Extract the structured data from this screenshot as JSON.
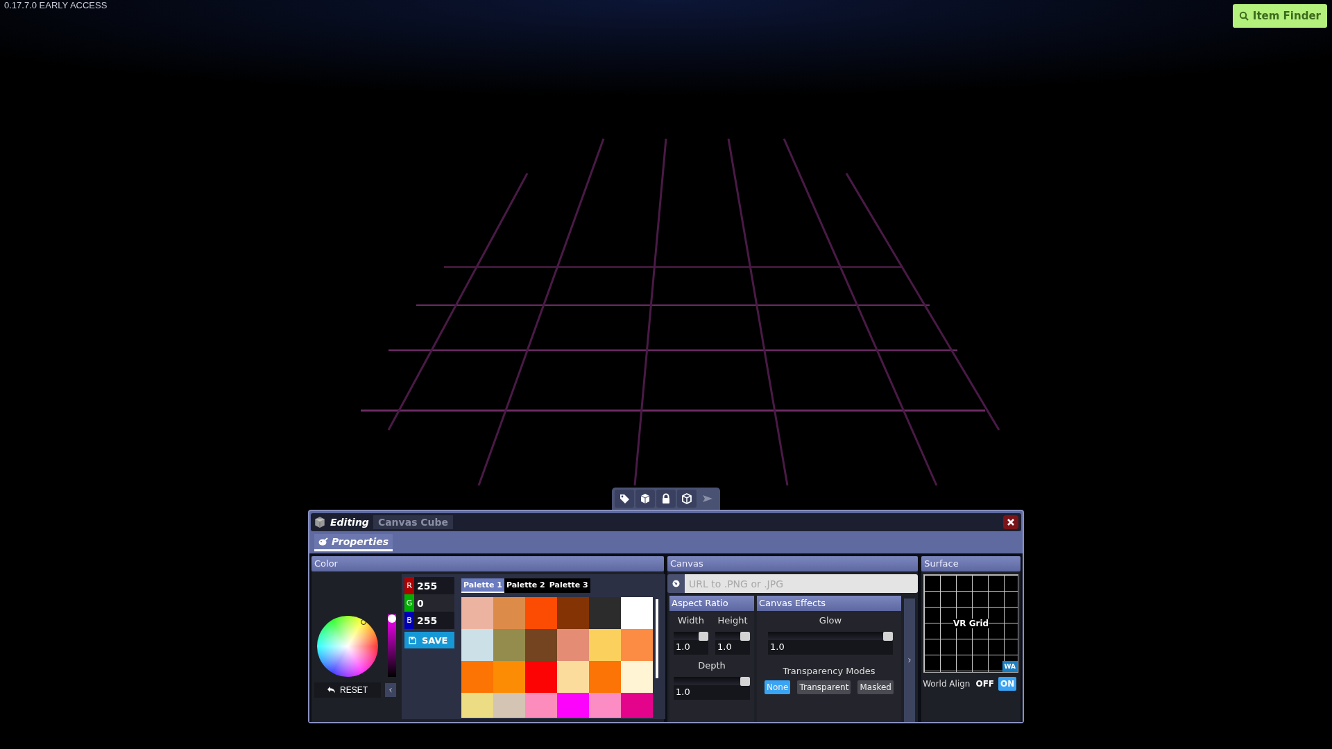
{
  "version_label": "0.17.7.0 EARLY ACCESS",
  "item_finder": {
    "label": "Item Finder"
  },
  "toolbar": [
    {
      "kind": "tag",
      "disabled": false
    },
    {
      "kind": "box",
      "disabled": false
    },
    {
      "kind": "lock",
      "disabled": false
    },
    {
      "kind": "cube",
      "disabled": false
    },
    {
      "kind": "play",
      "disabled": true
    }
  ],
  "editor": {
    "mode": "Editing",
    "object_name": "Canvas Cube"
  },
  "tabs": [
    {
      "label": "Properties",
      "selected": true
    }
  ],
  "color": {
    "title": "Color",
    "brightness": {
      "level": 1
    },
    "reset_label": "RESET",
    "channels": [
      {
        "label": "R",
        "value": "255",
        "color": "#b00000"
      },
      {
        "label": "G",
        "value": "0",
        "color": "#00b000"
      },
      {
        "label": "B",
        "value": "255",
        "color": "#0000b8"
      }
    ],
    "save_label": "SAVE",
    "palette_tabs": [
      {
        "label": "Palette 1",
        "selected": true
      },
      {
        "label": "Palette 2",
        "selected": false
      },
      {
        "label": "Palette 3",
        "selected": false
      }
    ],
    "swatches": [
      {
        "color": "#ecb4a0"
      },
      {
        "color": "#dc8c48"
      },
      {
        "color": "#fc4c04"
      },
      {
        "color": "#843404"
      },
      {
        "color": "#2c2c2c"
      },
      {
        "color": "#ffffff"
      },
      {
        "color": "#cce0e8"
      },
      {
        "color": "#948c4c"
      },
      {
        "color": "#744420"
      },
      {
        "color": "#e48c74"
      },
      {
        "color": "#fcd05c"
      },
      {
        "color": "#fc8c44"
      },
      {
        "color": "#fc7404"
      },
      {
        "color": "#fc8c04"
      },
      {
        "color": "#fc0404"
      },
      {
        "color": "#fcdc9c"
      },
      {
        "color": "#fc7405"
      },
      {
        "color": "#fff4d4"
      },
      {
        "color": "#ecdc84"
      },
      {
        "color": "#d4c4b4"
      },
      {
        "color": "#fc8cbc"
      },
      {
        "color": "#fc04fc"
      },
      {
        "color": "#fc8cc4"
      },
      {
        "color": "#e4048c"
      }
    ]
  },
  "canvas": {
    "title": "Canvas",
    "url_placeholder": "URL to .PNG or .JPG",
    "aspect_ratio": {
      "title": "Aspect Ratio",
      "sliders": [
        {
          "label": "Width",
          "level": 1,
          "value": "1.0"
        },
        {
          "label": "Height",
          "level": 1,
          "value": "1.0"
        },
        {
          "label": "Depth",
          "level": 1,
          "value": "1.0"
        }
      ]
    },
    "effects": {
      "title": "Canvas Effects",
      "glow": {
        "label": "Glow",
        "level": 1,
        "value": "1.0"
      },
      "transparency_title": "Transparency Modes",
      "modes": [
        {
          "label": "None",
          "selected": true
        },
        {
          "label": "Transparent",
          "selected": false
        },
        {
          "label": "Masked",
          "selected": false
        }
      ]
    }
  },
  "surface": {
    "title": "Surface",
    "texture_label": "VR Grid",
    "badge": "WA",
    "world_align": {
      "label": "World Align",
      "options": [
        {
          "label": "OFF",
          "selected": false
        },
        {
          "label": "ON",
          "selected": true
        }
      ]
    }
  }
}
